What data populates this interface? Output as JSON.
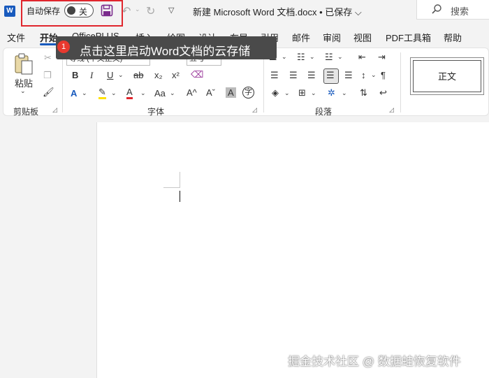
{
  "titlebar": {
    "logo": "W",
    "autosave_label": "自动保存",
    "autosave_state": "关",
    "doc_title": "新建 Microsoft Word 文档.docx • 已保存 ⌵",
    "search_placeholder": "搜索",
    "icons": [
      "word-logo-icon",
      "save-icon",
      "undo-icon",
      "redo-icon",
      "customize-quick-access-icon",
      "search-icon"
    ]
  },
  "tabs": [
    "文件",
    "开始",
    "OfficePLUS",
    "插入",
    "绘图",
    "设计",
    "布局",
    "引用",
    "邮件",
    "审阅",
    "视图",
    "PDF工具箱",
    "帮助"
  ],
  "active_tab": "开始",
  "tooltip": {
    "badge": "1",
    "text": "点击这里启动Word文档的云存储"
  },
  "ribbon": {
    "clipboard": {
      "paste_label": "粘贴",
      "group_label": "剪贴板"
    },
    "font": {
      "font_name": "等线 (中文正文)",
      "font_size": "五号",
      "group_label": "字体",
      "buttons": {
        "bold": "B",
        "italic": "I",
        "underline": "U",
        "strike": "ab",
        "subscript": "x₂",
        "superscript": "x²",
        "change_case": "Aa",
        "grow": "A^",
        "shrink": "Aˇ",
        "char_shading": "A",
        "enclose": "字",
        "font_color": "A",
        "effects": "A"
      }
    },
    "paragraph": {
      "group_label": "段落"
    },
    "styles": {
      "normal": "正文"
    }
  },
  "watermark": "掘金技术社区 @ 数据蛙恢复软件",
  "colors": {
    "accent": "#185abd",
    "highlight_red": "#e0262d",
    "badge_red": "#e8392f",
    "save_purple": "#7a2a8c"
  }
}
